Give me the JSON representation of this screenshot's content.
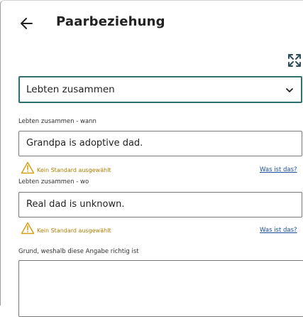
{
  "header": {
    "back_icon": "arrow-left-icon",
    "title": "Paarbeziehung",
    "expand_icon": "expand-arrows-icon"
  },
  "relationship_select": {
    "value": "Lebten zusammen",
    "chevron_icon": "chevron-down-icon"
  },
  "field_when": {
    "label": "Lebten zusammen - wann",
    "value": "Grandpa is adoptive dad.",
    "warning_icon": "warning-triangle-icon",
    "warning": "Kein Standard ausgewählt",
    "help_link": "Was ist das?"
  },
  "field_where": {
    "label": "Lebten zusammen - wo",
    "value": "Real dad is unknown.",
    "warning_icon": "warning-triangle-icon",
    "warning": "Kein Standard ausgewählt",
    "help_link": "Was ist das?"
  },
  "field_reason": {
    "label": "Grund, weshalb diese Angabe richtig ist",
    "value": ""
  },
  "colors": {
    "accent": "#2f6f6f",
    "warning": "#b07d00",
    "link": "#1a4fa0"
  }
}
